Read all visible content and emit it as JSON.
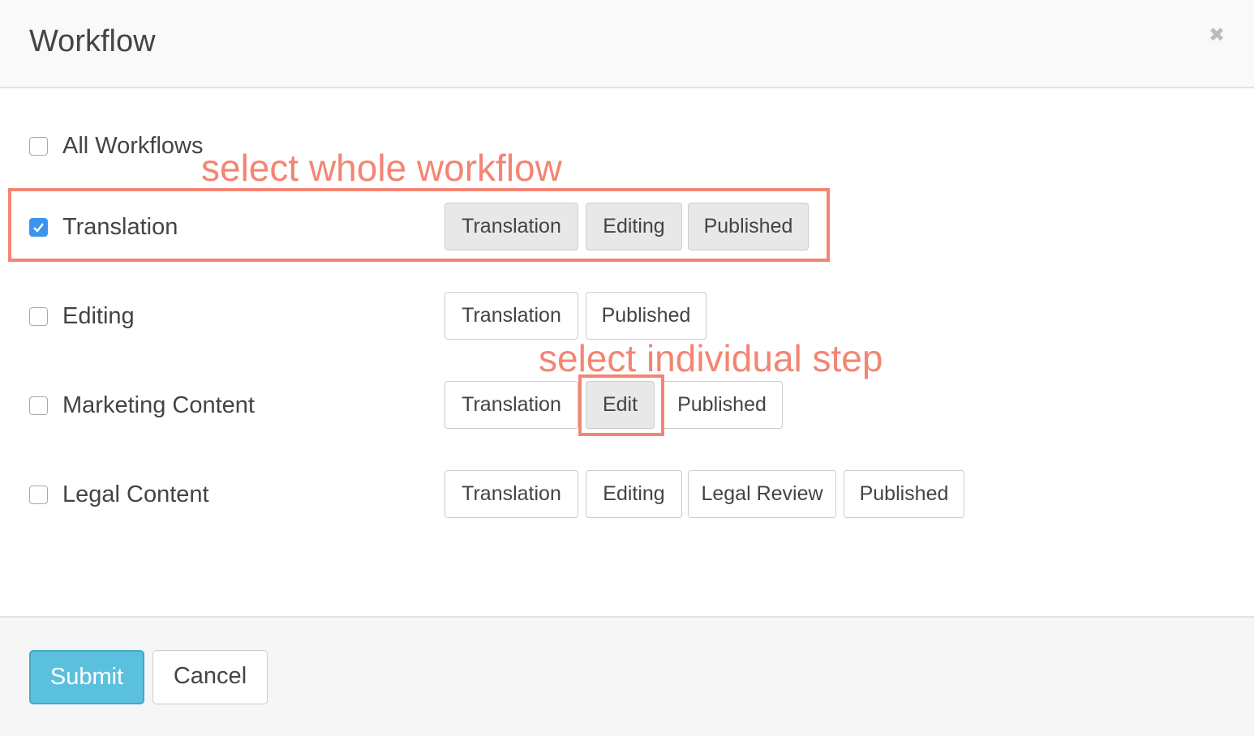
{
  "dialog": {
    "title": "Workflow",
    "close_icon": "close-icon"
  },
  "rows": [
    {
      "label": "All Workflows",
      "checked": false,
      "steps": []
    },
    {
      "label": "Translation",
      "checked": true,
      "steps": [
        "Translation",
        "Editing",
        "Published"
      ]
    },
    {
      "label": "Editing",
      "checked": false,
      "steps": [
        "Translation",
        "Published"
      ]
    },
    {
      "label": "Marketing Content",
      "checked": false,
      "steps": [
        "Translation",
        "Edit",
        "Published"
      ]
    },
    {
      "label": "Legal Content",
      "checked": false,
      "steps": [
        "Translation",
        "Editing",
        "Legal Review",
        "Published"
      ]
    }
  ],
  "annotations": {
    "whole_workflow": "select whole workflow",
    "individual_step": "select individual step",
    "color": "#f38573"
  },
  "footer": {
    "submit_label": "Submit",
    "cancel_label": "Cancel"
  },
  "colors": {
    "checkbox_checked": "#3b95ee",
    "submit_bg": "#5bc0de"
  }
}
